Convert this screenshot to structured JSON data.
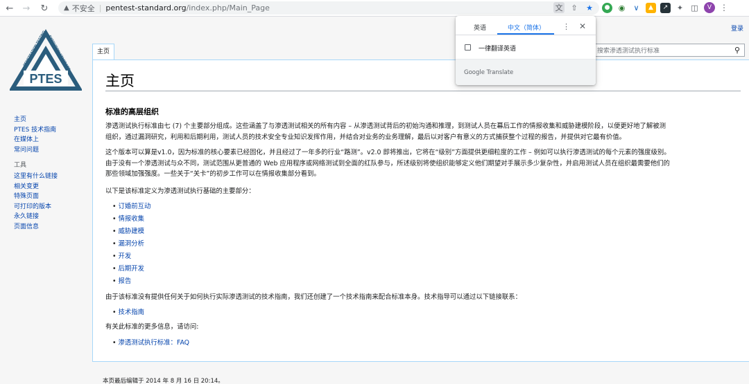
{
  "browser": {
    "insecure_label": "不安全",
    "url_host": "pentest-standard.org",
    "url_path": "/index.php/Main_Page",
    "profile_initial": "V"
  },
  "translate": {
    "tab_source": "英语",
    "tab_target": "中文（简体）",
    "always_translate": "一律翻译英语",
    "brand": "Google Translate"
  },
  "header": {
    "login": "登录",
    "tab_main": "主页",
    "search_placeholder": "搜索渗透测试执行标准"
  },
  "logo": {
    "name": "PTES",
    "ring_left": "PENETRATION TESTING",
    "ring_right": "EXECUTION STANDARD"
  },
  "sidebar": {
    "nav": [
      "主页",
      "PTES 技术指南",
      "在媒体上",
      "常问问题"
    ],
    "tools_title": "工具",
    "tools": [
      "这里有什么链接",
      "相关变更",
      "特殊页面",
      "可打印的版本",
      "永久链接",
      "页面信息"
    ]
  },
  "article": {
    "title": "主页",
    "section_title": "标准的高层组织",
    "p1": [
      "渗透测试执行标准由七 (7) 个主要部分组成。这些涵盖了与渗透测试相关的所有内容 – 从渗透测试背后的初始沟通和推理，到测试人员在幕后工作的情报收集和威胁建模阶段，以便更好地了解被测",
      "组织，通过漏洞研究，利用和后期利用，测试人员的技术安全专业知识发挥作用，并结合对业务的业务理解，最后以对客户有意义的方式捕获整个过程的报告，并提供对它最有价值。"
    ],
    "p2": [
      "这个版本可以算是v1.0，因为标准的核心要素已经固化，并且经过了一年多的行业“路测”。v2.0 即将推出，它将在“级别”方面提供更细粒度的工作 – 例如可以执行渗透测试的每个元素的强度级别。",
      "由于没有一个渗透测试与众不同，测试范围从更普通的 Web 应用程序或网络测试到全面的红队参与，所述级别将使组织能够定义他们期望对手展示多少复杂性，并启用测试人员在组织最需要他们的",
      "那些领域加强强度。一些关于“关卡”的初步工作可以在情报收集部分看到。"
    ],
    "p3": "以下是该标准定义为渗透测试执行基础的主要部分：",
    "sections": [
      "订婚前互动",
      "情报收集",
      "威胁建模",
      "漏洞分析",
      "开发",
      "后期开发",
      "报告"
    ],
    "p4": "由于该标准没有提供任何关于如何执行实际渗透测试的技术指南，我们还创建了一个技术指南来配合标准本身。技术指导可以通过以下链接联系：",
    "tech_link": "技术指南",
    "p5": "有关此标准的更多信息，请访问:",
    "faq_link": "渗透测试执行标准：FAQ",
    "footer": "本页最后编辑于 2014 年 8 月 16 日 20:14。"
  },
  "colors": {
    "link": "#0645ad",
    "border": "#a7d7f9",
    "logo": "#2b5d7d",
    "accent": "#1a73e8"
  }
}
